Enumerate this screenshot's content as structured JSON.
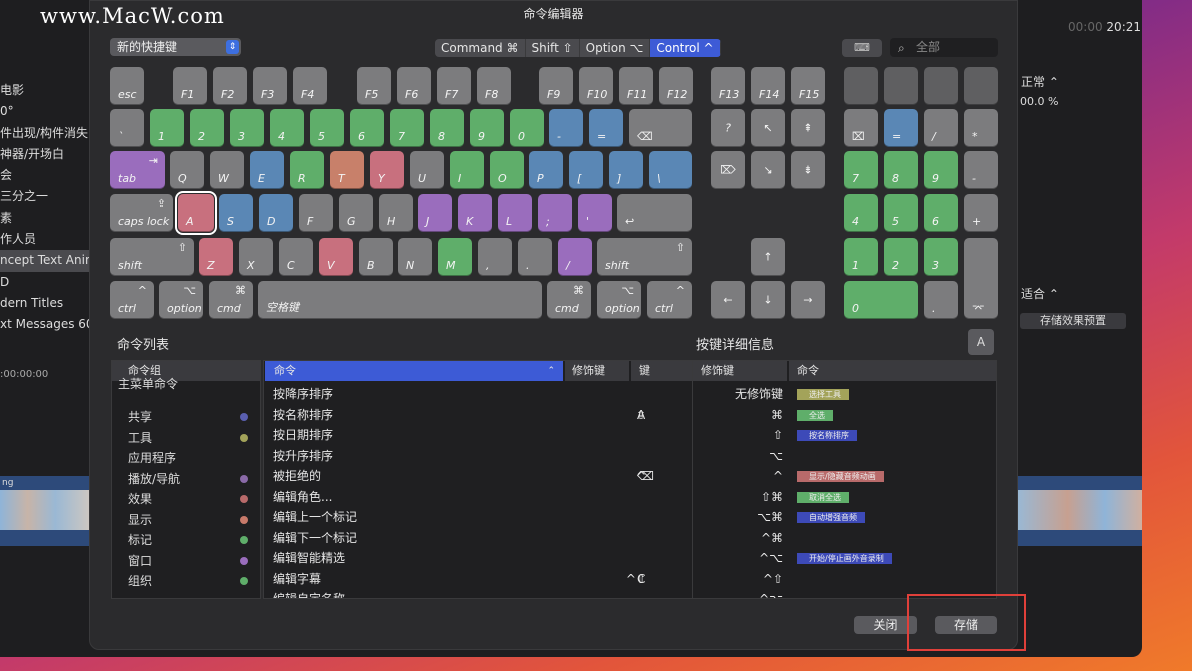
{
  "watermark": "www.MacW.com",
  "background_app": {
    "left_items": [
      "电影",
      "0°",
      "件出现/构件消失",
      "神器/开场白",
      "会",
      "三分之一",
      "素",
      "作人员",
      "ncept Text Anim",
      "D",
      "dern Titles",
      "xt Messages 60"
    ],
    "timecode_left": ":00:00:00",
    "timecode_right_a": "00:00",
    "timecode_right_b": "20:21",
    "inspector_mode": "正常 ⌃",
    "opacity": "00.0 %",
    "fit": "适合 ⌃",
    "save_effect": "存储效果预置",
    "clip_label": "ng"
  },
  "dialog": {
    "title": "命令编辑器",
    "preset": "新的快捷键",
    "modifiers": [
      "Command ⌘",
      "Shift ⇧",
      "Option ⌥",
      "Control ^"
    ],
    "active_modifier": 3,
    "keyboard_icon": "⌨",
    "search_placeholder": "全部",
    "keys": {
      "esc": "esc",
      "f1": "F1",
      "f2": "F2",
      "f3": "F3",
      "f4": "F4",
      "f5": "F5",
      "f6": "F6",
      "f7": "F7",
      "f8": "F8",
      "f9": "F9",
      "f10": "F10",
      "f11": "F11",
      "f12": "F12",
      "f13": "F13",
      "f14": "F14",
      "f15": "F15",
      "backtick": "`",
      "n1": "1",
      "n2": "2",
      "n3": "3",
      "n4": "4",
      "n5": "5",
      "n6": "6",
      "n7": "7",
      "n8": "8",
      "n9": "9",
      "n0": "0",
      "minus": "-",
      "equal": "=",
      "delete": "⌫",
      "tab": "tab",
      "tab_glyph": "⇥",
      "q": "Q",
      "w": "W",
      "e": "E",
      "r": "R",
      "t": "T",
      "y": "Y",
      "u": "U",
      "i": "I",
      "o": "O",
      "p": "P",
      "lbr": "[",
      "rbr": "]",
      "bslash": "\\",
      "caps": "caps lock",
      "caps_glyph": "⇪",
      "a": "A",
      "s": "S",
      "d": "D",
      "f": "F",
      "g": "G",
      "h": "H",
      "j": "J",
      "k": "K",
      "l": "L",
      "semi": ";",
      "quote": "'",
      "ret": "↩",
      "shift": "shift",
      "shift_glyph": "⇧",
      "z": "Z",
      "x": "X",
      "c": "C",
      "v": "V",
      "b": "B",
      "n": "N",
      "m": "M",
      "comma": ",",
      "period": ".",
      "slash": "/",
      "ctrl": "ctrl",
      "ctrl_glyph": "^",
      "option": "option",
      "option_glyph": "⌥",
      "cmd": "cmd",
      "cmd_glyph": "⌘",
      "space": "空格键",
      "help": "?",
      "home": "↖",
      "pgup": "⇞",
      "fdel": "⌦",
      "end": "↘",
      "pgdn": "⇟",
      "up": "↑",
      "left": "←",
      "down": "↓",
      "right": "→",
      "clear": "⌧",
      "kpeq": "=",
      "kpdiv": "/",
      "kpmul": "*",
      "kpminus": "-",
      "kp7": "7",
      "kp8": "8",
      "kp9": "9",
      "kp4": "4",
      "kp5": "5",
      "kp6": "6",
      "kpplus": "+",
      "kp1": "1",
      "kp2": "2",
      "kp3": "3",
      "kp0": "0",
      "kpdot": ".",
      "kpenter": "⌤"
    },
    "command_list": {
      "title": "命令列表",
      "group_header": "命令组",
      "groups": [
        {
          "label": "主菜单命令",
          "color": ""
        },
        {
          "label": "共享",
          "color": "#5a5fb0"
        },
        {
          "label": "工具",
          "color": "#a3a35a"
        },
        {
          "label": "应用程序",
          "color": ""
        },
        {
          "label": "播放/导航",
          "color": "#8a6aa8"
        },
        {
          "label": "效果",
          "color": "#b86a6a"
        },
        {
          "label": "显示",
          "color": "#c87a6a"
        },
        {
          "label": "标记",
          "color": "#5fae6a"
        },
        {
          "label": "窗口",
          "color": "#9a6dbd"
        },
        {
          "label": "组织",
          "color": "#5fae6a"
        }
      ],
      "headers": {
        "command": "命令",
        "modifier": "修饰键",
        "key": "键"
      },
      "rows": [
        {
          "name": "按降序排序",
          "mod": "",
          "key": ""
        },
        {
          "name": "按名称排序",
          "mod": "⇧",
          "key": "A"
        },
        {
          "name": "按日期排序",
          "mod": "",
          "key": ""
        },
        {
          "name": "按升序排序",
          "mod": "",
          "key": ""
        },
        {
          "name": "被拒绝的",
          "mod": "^",
          "key": "⌫"
        },
        {
          "name": "编辑角色...",
          "mod": "",
          "key": ""
        },
        {
          "name": "编辑上一个标记",
          "mod": "",
          "key": ""
        },
        {
          "name": "编辑下一个标记",
          "mod": "",
          "key": ""
        },
        {
          "name": "编辑智能精选",
          "mod": "",
          "key": ""
        },
        {
          "name": "编辑字幕",
          "mod": "^⇧",
          "key": "C"
        },
        {
          "name": "编辑自定名称",
          "mod": "",
          "key": ""
        }
      ]
    },
    "key_detail": {
      "title": "按键详细信息",
      "key": "A",
      "headers": {
        "modifier": "修饰键",
        "command": "命令"
      },
      "rows": [
        {
          "mod": "无修饰键",
          "cmd": "选择工具",
          "color": "#a3a35a"
        },
        {
          "mod": "⌘",
          "cmd": "全选",
          "color": "#5fae6a"
        },
        {
          "mod": "⇧",
          "cmd": "按名称排序",
          "color": "#3d4ab8"
        },
        {
          "mod": "⌥",
          "cmd": "",
          "color": ""
        },
        {
          "mod": "^",
          "cmd": "显示/隐藏音频动画",
          "color": "#b86a6a"
        },
        {
          "mod": "⇧⌘",
          "cmd": "取消全选",
          "color": "#5fae6a"
        },
        {
          "mod": "⌥⌘",
          "cmd": "自动增强音频",
          "color": "#3d4ab8"
        },
        {
          "mod": "^⌘",
          "cmd": "",
          "color": ""
        },
        {
          "mod": "^⌥",
          "cmd": "开始/停止画外音录制",
          "color": "#3d4ab8"
        },
        {
          "mod": "^⇧",
          "cmd": "",
          "color": ""
        },
        {
          "mod": "^⌥",
          "cmd": "",
          "color": ""
        }
      ]
    },
    "close": "关闭",
    "save": "存储"
  }
}
